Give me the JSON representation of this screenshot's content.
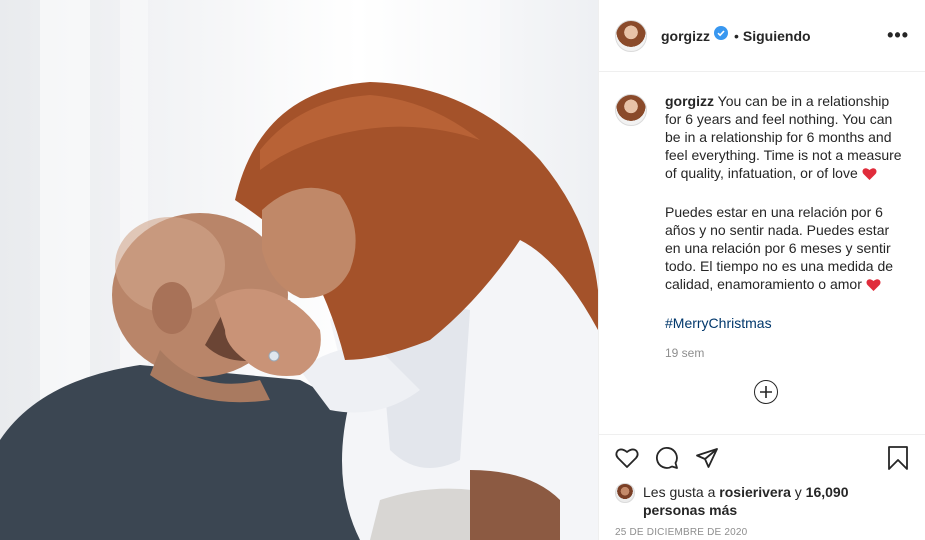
{
  "post": {
    "username": "gorgizz",
    "follow_status": "Siguiendo",
    "separator": "•",
    "more_label": "•••"
  },
  "caption": {
    "username": "gorgizz",
    "paragraph_en": "You can be in a relationship for 6 years and feel nothing. You can be in a relationship for 6 months and feel everything. Time is not a measure of quality, infatuation, or of love",
    "paragraph_es": "Puedes estar en una relación por 6 años y no sentir nada. Puedes estar en una relación por 6 meses y sentir todo. El tiempo no es una medida de calidad, enamoramiento o amor",
    "hashtag": "#MerryChristmas",
    "time_ago": "19 sem"
  },
  "likes": {
    "prefix": "Les gusta a",
    "liker": "rosierivera",
    "conjunction": "y",
    "count_text": "16,090 personas más"
  },
  "date": "25 DE DICIEMBRE DE 2020",
  "icons": [
    "heart-icon",
    "comment-icon",
    "share-icon",
    "bookmark-icon",
    "plus-circle-icon",
    "verified-badge-icon",
    "red-heart-emoji-icon"
  ],
  "colors": {
    "verified_blue": "#3897f0",
    "hashtag": "#00376b",
    "heart_emoji": "#e02c3b",
    "muted_text": "#8e8e8e"
  }
}
